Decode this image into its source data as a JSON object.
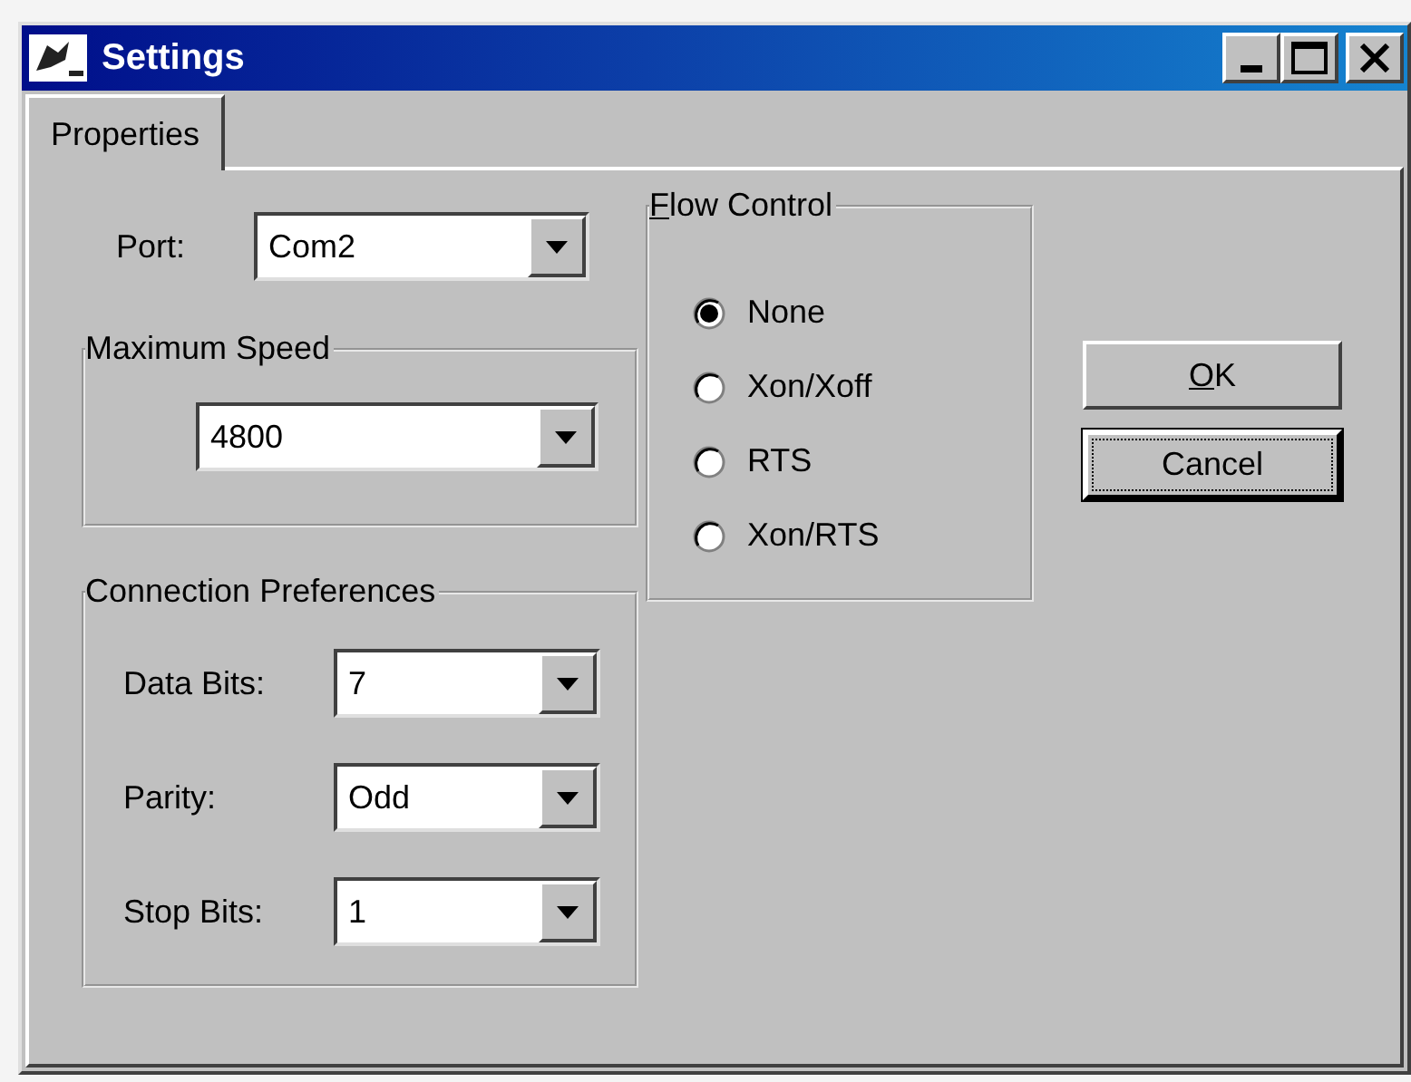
{
  "window": {
    "title": "Settings"
  },
  "tabs": [
    {
      "label": "Properties",
      "selected": true
    }
  ],
  "port": {
    "label": "Port:",
    "value": "Com2"
  },
  "maximum_speed": {
    "title": "Maximum Speed",
    "value": "4800"
  },
  "connection_preferences": {
    "title": "Connection Preferences",
    "fields": [
      {
        "label": "Data Bits:",
        "value": "7"
      },
      {
        "label": "Parity:",
        "value": "Odd"
      },
      {
        "label": "Stop Bits:",
        "value": "1"
      }
    ]
  },
  "flow_control": {
    "title": "Flow Control",
    "mnemonic": true,
    "options": [
      {
        "label": "None",
        "selected": true
      },
      {
        "label": "Xon/Xoff",
        "selected": false
      },
      {
        "label": "RTS",
        "selected": false
      },
      {
        "label": "Xon/RTS",
        "selected": false
      }
    ]
  },
  "buttons": [
    {
      "label": "OK",
      "mnemonic": true,
      "focused": false
    },
    {
      "label": "Cancel",
      "mnemonic": false,
      "focused": true
    }
  ]
}
